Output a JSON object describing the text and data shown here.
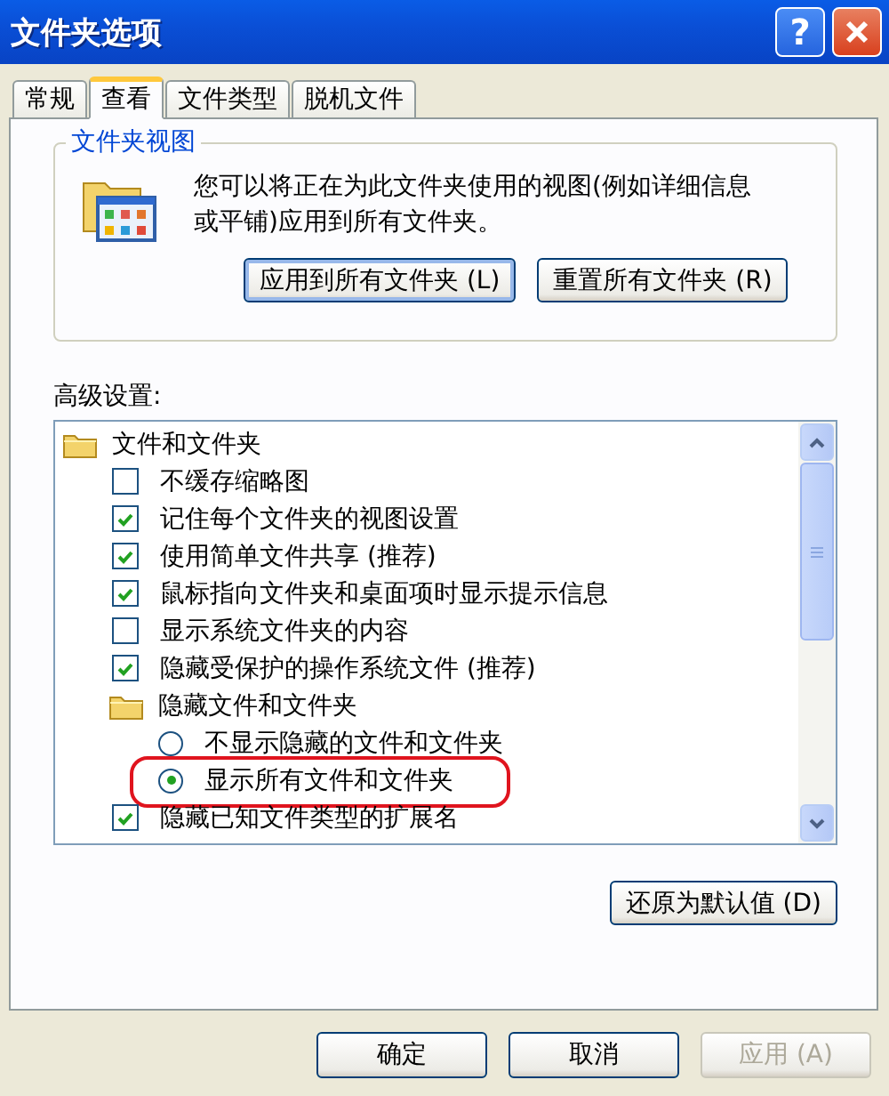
{
  "window": {
    "title": "文件夹选项",
    "help_button": "?"
  },
  "tabs": [
    {
      "label": "常规",
      "selected": false
    },
    {
      "label": "查看",
      "selected": true
    },
    {
      "label": "文件类型",
      "selected": false
    },
    {
      "label": "脱机文件",
      "selected": false
    }
  ],
  "folder_views": {
    "title": "文件夹视图",
    "description": "您可以将正在为此文件夹使用的视图(例如详细信息或平铺)应用到所有文件夹。",
    "buttons": [
      {
        "label": "应用到所有文件夹 (L)",
        "focused": true
      },
      {
        "label": "重置所有文件夹 (R)",
        "focused": false
      }
    ]
  },
  "advanced": {
    "label": "高级设置:",
    "items": [
      {
        "kind": "folder",
        "label": "文件和文件夹",
        "children": [
          {
            "kind": "checkbox",
            "label": "不缓存缩略图",
            "checked": false
          },
          {
            "kind": "checkbox",
            "label": "记住每个文件夹的视图设置",
            "checked": true
          },
          {
            "kind": "checkbox",
            "label": "使用简单文件共享 (推荐)",
            "checked": true
          },
          {
            "kind": "checkbox",
            "label": "鼠标指向文件夹和桌面项时显示提示信息",
            "checked": true
          },
          {
            "kind": "checkbox",
            "label": "显示系统文件夹的内容",
            "checked": false
          },
          {
            "kind": "checkbox",
            "label": "隐藏受保护的操作系统文件 (推荐)",
            "checked": true
          },
          {
            "kind": "folder",
            "label": "隐藏文件和文件夹",
            "children": [
              {
                "kind": "radio",
                "label": "不显示隐藏的文件和文件夹",
                "selected": false,
                "highlighted": false
              },
              {
                "kind": "radio",
                "label": "显示所有文件和文件夹",
                "selected": true,
                "highlighted": true
              }
            ]
          },
          {
            "kind": "checkbox",
            "label": "隐藏已知文件类型的扩展名",
            "checked": true
          }
        ]
      }
    ],
    "restore_button": "还原为默认值 (D)"
  },
  "buttons": [
    {
      "label": "确定",
      "disabled": false
    },
    {
      "label": "取消",
      "disabled": false
    },
    {
      "label": "应用 (A)",
      "disabled": true
    }
  ]
}
